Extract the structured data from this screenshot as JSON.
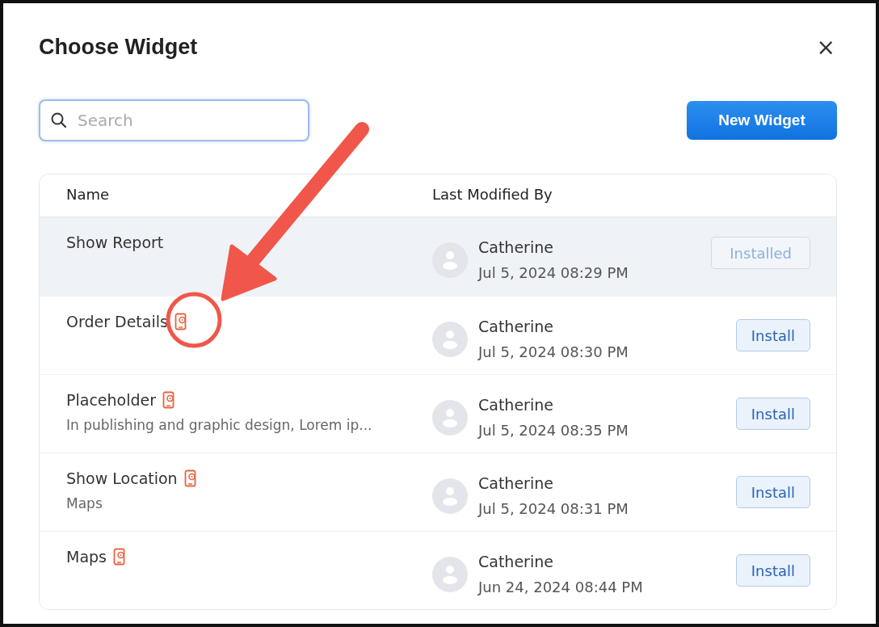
{
  "dialog": {
    "title": "Choose Widget",
    "close": "×"
  },
  "search": {
    "placeholder": "Search"
  },
  "new_button": "New Widget",
  "table": {
    "columns": [
      "Name",
      "Last Modified By"
    ],
    "rows": [
      {
        "name": "Show Report",
        "mobile": false,
        "author": "Catherine",
        "date": "Jul 5, 2024 08:29 PM",
        "action": "Installed",
        "installed": true,
        "selected": true
      },
      {
        "name": "Order Details",
        "mobile": true,
        "author": "Catherine",
        "date": "Jul 5, 2024 08:30 PM",
        "action": "Install",
        "installed": false,
        "selected": false
      },
      {
        "name": "Placeholder",
        "mobile": true,
        "description": "In publishing and graphic design, Lorem ip...",
        "author": "Catherine",
        "date": "Jul 5, 2024 08:35 PM",
        "action": "Install",
        "installed": false,
        "selected": false
      },
      {
        "name": "Show Location",
        "mobile": true,
        "description": "Maps",
        "author": "Catherine",
        "date": "Jul 5, 2024 08:31 PM",
        "action": "Install",
        "installed": false,
        "selected": false
      },
      {
        "name": "Maps",
        "mobile": true,
        "author": "Catherine",
        "date": "Jun 24, 2024 08:44 PM",
        "action": "Install",
        "installed": false,
        "selected": false
      }
    ]
  }
}
